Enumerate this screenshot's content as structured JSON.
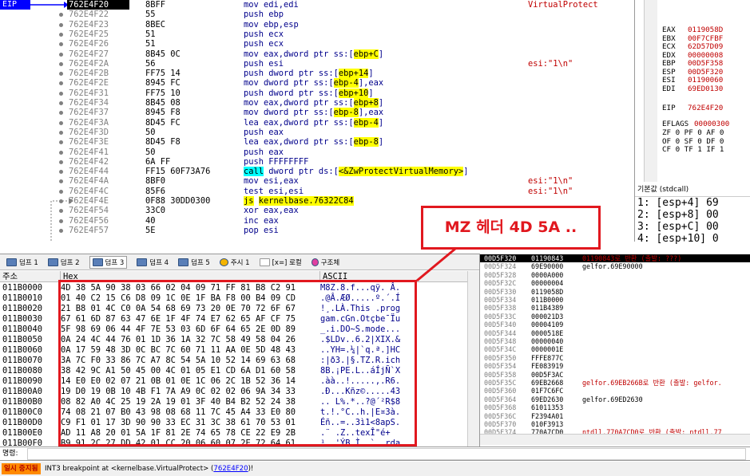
{
  "disasm": {
    "eip_label": "EIP",
    "rows": [
      {
        "addr": "762E4F20",
        "bytes": "8BFF",
        "instr": "mov edi,edi",
        "comment": "VirtualProtect"
      },
      {
        "addr": "762E4F22",
        "bytes": "55",
        "instr": "push ebp",
        "comment": ""
      },
      {
        "addr": "762E4F23",
        "bytes": "8BEC",
        "instr": "mov ebp,esp",
        "comment": ""
      },
      {
        "addr": "762E4F25",
        "bytes": "51",
        "instr": "push ecx",
        "comment": ""
      },
      {
        "addr": "762E4F26",
        "bytes": "51",
        "instr": "push ecx",
        "comment": ""
      },
      {
        "addr": "762E4F27",
        "bytes": "8B45 0C",
        "instr": "mov eax,dword ptr ss:[ebp+C]",
        "comment": ""
      },
      {
        "addr": "762E4F2A",
        "bytes": "56",
        "instr": "push esi",
        "comment": "esi:\"1\\n\""
      },
      {
        "addr": "762E4F2B",
        "bytes": "FF75 14",
        "instr": "push dword ptr ss:[ebp+14]",
        "comment": ""
      },
      {
        "addr": "762E4F2E",
        "bytes": "8945 FC",
        "instr": "mov dword ptr ss:[ebp-4],eax",
        "comment": ""
      },
      {
        "addr": "762E4F31",
        "bytes": "FF75 10",
        "instr": "push dword ptr ss:[ebp+10]",
        "comment": ""
      },
      {
        "addr": "762E4F34",
        "bytes": "8B45 08",
        "instr": "mov eax,dword ptr ss:[ebp+8]",
        "comment": ""
      },
      {
        "addr": "762E4F37",
        "bytes": "8945 F8",
        "instr": "mov dword ptr ss:[ebp-8],eax",
        "comment": ""
      },
      {
        "addr": "762E4F3A",
        "bytes": "8D45 FC",
        "instr": "lea eax,dword ptr ss:[ebp-4]",
        "comment": ""
      },
      {
        "addr": "762E4F3D",
        "bytes": "50",
        "instr": "push eax",
        "comment": ""
      },
      {
        "addr": "762E4F3E",
        "bytes": "8D45 F8",
        "instr": "lea eax,dword ptr ss:[ebp-8]",
        "comment": ""
      },
      {
        "addr": "762E4F41",
        "bytes": "50",
        "instr": "push eax",
        "comment": ""
      },
      {
        "addr": "762E4F42",
        "bytes": "6A FF",
        "instr": "push FFFFFFFF",
        "comment": ""
      },
      {
        "addr": "762E4F44",
        "bytes": "FF15 60F73A76",
        "instr": "call dword ptr ds:[<&ZwProtectVirtualMemory>]",
        "comment": ""
      },
      {
        "addr": "762E4F4A",
        "bytes": "8BF0",
        "instr": "mov esi,eax",
        "comment": "esi:\"1\\n\""
      },
      {
        "addr": "762E4F4C",
        "bytes": "85F6",
        "instr": "test esi,esi",
        "comment": "esi:\"1\\n\""
      },
      {
        "addr": "762E4F4E",
        "bytes": "0F88 30DD0300",
        "instr": "js kernelbase.76322C84",
        "comment": ""
      },
      {
        "addr": "762E4F54",
        "bytes": "33C0",
        "instr": "xor eax,eax",
        "comment": ""
      },
      {
        "addr": "762E4F56",
        "bytes": "40",
        "instr": "inc eax",
        "comment": ""
      },
      {
        "addr": "762E4F57",
        "bytes": "5E",
        "instr": "pop esi",
        "comment": ""
      }
    ]
  },
  "registers": {
    "gpr": [
      {
        "name": "EAX",
        "value": "0119058D"
      },
      {
        "name": "EBX",
        "value": "00F7CFBF"
      },
      {
        "name": "ECX",
        "value": "62D57D09"
      },
      {
        "name": "EDX",
        "value": "00000008"
      },
      {
        "name": "EBP",
        "value": "00D5F358"
      },
      {
        "name": "ESP",
        "value": "00D5F320"
      },
      {
        "name": "ESI",
        "value": "01190060"
      },
      {
        "name": "EDI",
        "value": "69ED0130"
      }
    ],
    "eip": {
      "name": "EIP",
      "value": "762E4F20"
    },
    "eflags": {
      "name": "EFLAGS",
      "value": "00000300"
    },
    "flags_rows": [
      "ZF 0  PF 0  AF 0",
      "OF 0  SF 0  DF 0",
      "CF 0  TF 1  IF 1"
    ],
    "callconv": "기본값 (stdcall)",
    "args": [
      "1: [esp+4] 69",
      "2: [esp+8] 00",
      "3: [esp+C] 00",
      "4: [esp+10] 0"
    ]
  },
  "hex": {
    "tabs": [
      "덤프 1",
      "덤프 2",
      "덤프 3",
      "덤프 4",
      "덤프 5",
      "주시 1",
      "[x=] 로컬",
      "구조체"
    ],
    "col_addr": "주소",
    "col_hex": "Hex",
    "col_ascii": "ASCII",
    "rows": [
      {
        "addr": "011B0000",
        "hex": "4D 38 5A 90 38 03 66 02 04 09 71 FF 81 B8 C2 91",
        "ascii": "M8Z.8.f...qÿ. Â."
      },
      {
        "addr": "011B0010",
        "hex": "01 40 C2 15 C6 D8 09 1C 0E 1F BA F8 00 B4 09 CD",
        "ascii": ".@Â.ÆØ.....º.´.Í"
      },
      {
        "addr": "011B0020",
        "hex": "21 B8 01 4C C0 0A 54 68 69 73 20 0E 70 72 6F 67",
        "ascii": "!¸.LÀ.This .prog"
      },
      {
        "addr": "011B0030",
        "hex": "67 61 6D 87 63 47 6E 1F 4F 74 E7 62 65 AF CF 75",
        "ascii": "gam.cGn.Otçbe¯Ïu"
      },
      {
        "addr": "011B0040",
        "hex": "5F 98 69 06 44 4F 7E 53 03 6D 6F 64 65 2E 0D 89",
        "ascii": "_.i.DO~S.mode..."
      },
      {
        "addr": "011B0050",
        "hex": "0A 24 4C 44 76 01 1D 36 1A 32 7C 58 49 58 04 26",
        "ascii": ".$LDv..6.2|XIX.&"
      },
      {
        "addr": "011B0060",
        "hex": "0A 17 59 48 3D 0C BC 7C 60 71 11 AA 0E 5D 48 43",
        "ascii": "..YH=.¼|`q.ª.]HC"
      },
      {
        "addr": "011B0070",
        "hex": "3A 7C F0 33 86 7C A7 8C 54 5A 10 52 14 69 63 68",
        "ascii": ":|ð3.|§.TZ.R.ich"
      },
      {
        "addr": "011B0080",
        "hex": "38 42 9C A1 50 45 00 4C 01 05 E1 CD 6A D1 60 58",
        "ascii": "8B.¡PE.L..áÍjÑ`X"
      },
      {
        "addr": "011B0090",
        "hex": "14 E0 E0 02 07 21 0B 01 0E 1C 06 2C 1B 52 36 14",
        "ascii": ".àà..!.....,.R6."
      },
      {
        "addr": "011B00A0",
        "hex": "19 D0 19 0B 10 4B F1 7A A9 0C 02 02 06 9A 34 33",
        "ascii": ".Ð...Kñz©.....43"
      },
      {
        "addr": "011B00B0",
        "hex": "08 82 A0 4C 25 19 2A 19 01 3F 40 B4 B2 52 24 38",
        "ascii": ".. L%.*..?@´²R$8"
      },
      {
        "addr": "011B00C0",
        "hex": "74 08 21 07 B0 43 98 08 68 11 7C 45 A4 33 E0 80",
        "ascii": "t.!.°C..h.|E¤3à."
      },
      {
        "addr": "011B00D0",
        "hex": "C9 F1 01 17 3D 90 90 33 EC 31 3C 38 61 70 53 01",
        "ascii": "Éñ..=..3ì1<8apS."
      },
      {
        "addr": "011B00E0",
        "hex": "AD 11 A8 20 01 5A 1F 81 2E 74 65 78 CE 22 E9 2B",
        "ascii": "­.¨ .Z..texÎ\"é+"
      },
      {
        "addr": "011B00F0",
        "hex": "B9 91 2C 27 DD 42 01 CC 20 06 60 07 2E 72 64 61",
        "ascii": "¹.,'ÝB.Ì .`..rda"
      }
    ]
  },
  "annotation": {
    "label": "MZ 헤더 4D 5A .."
  },
  "stack": {
    "rows": [
      {
        "addr": "00D5F320",
        "val": "01190843",
        "cmt": "01190843로 반환 (출발: ???)"
      },
      {
        "addr": "00D5F324",
        "val": "69E90000",
        "cmt": "gelfor.69E90000"
      },
      {
        "addr": "00D5F328",
        "val": "0000A000",
        "cmt": ""
      },
      {
        "addr": "00D5F32C",
        "val": "00000004",
        "cmt": ""
      },
      {
        "addr": "00D5F330",
        "val": "0119058D",
        "cmt": ""
      },
      {
        "addr": "00D5F334",
        "val": "011B0000",
        "cmt": ""
      },
      {
        "addr": "00D5F338",
        "val": "011B4389",
        "cmt": ""
      },
      {
        "addr": "00D5F33C",
        "val": "000021D3",
        "cmt": ""
      },
      {
        "addr": "00D5F340",
        "val": "00004109",
        "cmt": ""
      },
      {
        "addr": "00D5F344",
        "val": "0000518E",
        "cmt": ""
      },
      {
        "addr": "00D5F348",
        "val": "00000040",
        "cmt": ""
      },
      {
        "addr": "00D5F34C",
        "val": "0000001E",
        "cmt": ""
      },
      {
        "addr": "00D5F350",
        "val": "FFFE877C",
        "cmt": ""
      },
      {
        "addr": "00D5F354",
        "val": "FE083919",
        "cmt": ""
      },
      {
        "addr": "00D5F358",
        "val": "00D5F3AC",
        "cmt": ""
      },
      {
        "addr": "00D5F35C",
        "val": "69EB2668",
        "cmt": "gelfor.69EB266B로 반환 (출발: gelfor."
      },
      {
        "addr": "00D5F360",
        "val": "01F7C6FC",
        "cmt": ""
      },
      {
        "addr": "00D5F364",
        "val": "69ED2630",
        "cmt": "gelfor.69ED2630"
      },
      {
        "addr": "00D5F368",
        "val": "61011353",
        "cmt": ""
      },
      {
        "addr": "00D5F36C",
        "val": "F2394A01",
        "cmt": ""
      },
      {
        "addr": "00D5F370",
        "val": "010F3913",
        "cmt": ""
      },
      {
        "addr": "00D5F374",
        "val": "770A7CD0",
        "cmt": "ntdll.770A7CD0로 반환 (출발: ntdll.77"
      }
    ]
  },
  "command": {
    "label": "명령:",
    "value": ""
  },
  "status": {
    "paused": "일시 중지됨",
    "message": "INT3 breakpoint at <kernelbase.VirtualProtect> (",
    "link": "762E4F20",
    "tail": ")!"
  }
}
